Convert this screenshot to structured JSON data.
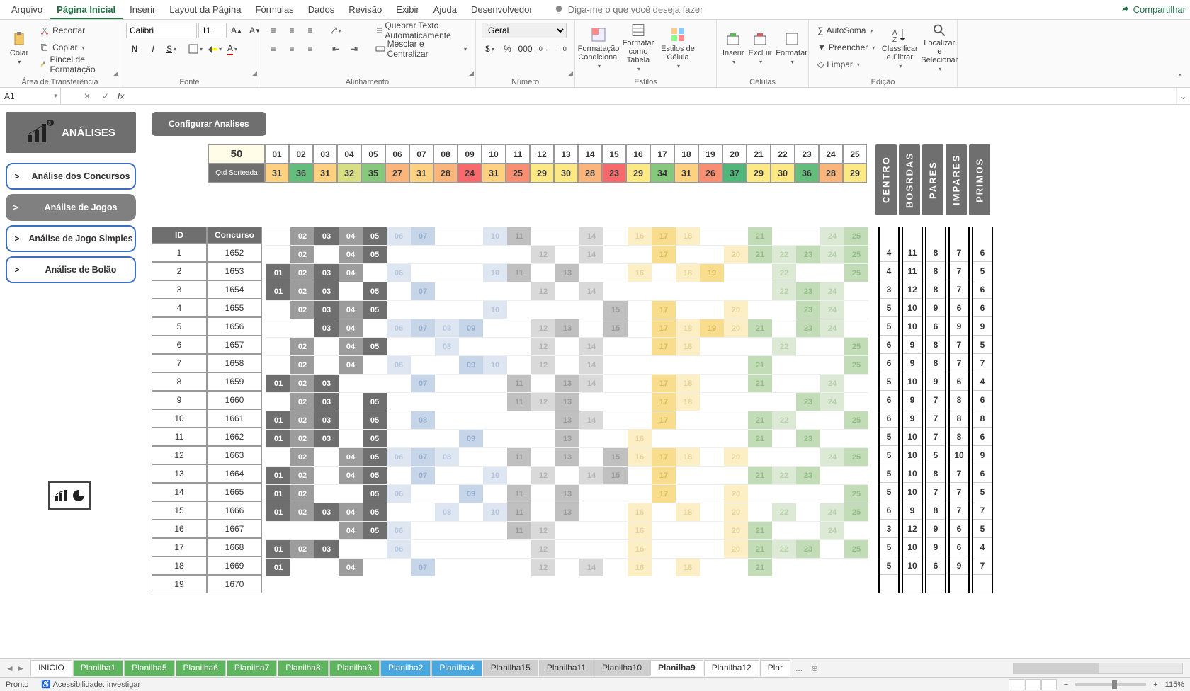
{
  "menu": {
    "items": [
      "Arquivo",
      "Página Inicial",
      "Inserir",
      "Layout da Página",
      "Fórmulas",
      "Dados",
      "Revisão",
      "Exibir",
      "Ajuda",
      "Desenvolvedor"
    ],
    "active": 1,
    "tellme": "Diga-me o que você deseja fazer",
    "share": "Compartilhar"
  },
  "ribbon": {
    "clipboard": {
      "paste": "Colar",
      "cut": "Recortar",
      "copy": "Copiar",
      "painter": "Pincel de Formatação",
      "label": "Área de Transferência"
    },
    "font": {
      "name": "Calibri",
      "size": "11",
      "label": "Fonte"
    },
    "alignment": {
      "wrap": "Quebrar Texto Automaticamente",
      "merge": "Mesclar e Centralizar",
      "label": "Alinhamento"
    },
    "number": {
      "format": "Geral",
      "label": "Número"
    },
    "styles": {
      "cond": "Formatação Condicional",
      "table": "Formatar como Tabela",
      "cell": "Estilos de Célula",
      "label": "Estilos"
    },
    "cells": {
      "insert": "Inserir",
      "delete": "Excluir",
      "format": "Formatar",
      "label": "Células"
    },
    "editing": {
      "sum": "AutoSoma",
      "fill": "Preencher",
      "clear": "Limpar",
      "sort": "Classificar e Filtrar",
      "find": "Localizar e Selecionar",
      "label": "Edição"
    }
  },
  "namebox": "A1",
  "panel": {
    "title": "ANÁLISES",
    "buttons": [
      "Análise dos Concursos",
      "Análise de Jogos",
      "Análise de Jogo Simples",
      "Análise de Bolão"
    ],
    "active": 1,
    "config": "Configurar Analises"
  },
  "vert_labels": [
    "CENTRO",
    "BOSRDAS",
    "PARES",
    "IMPARES",
    "PRIMOS"
  ],
  "header": {
    "total": "50",
    "qtd_label": "Qtd Sorteada",
    "cols": [
      "01",
      "02",
      "03",
      "04",
      "05",
      "06",
      "07",
      "08",
      "09",
      "10",
      "11",
      "12",
      "13",
      "14",
      "15",
      "16",
      "17",
      "18",
      "19",
      "20",
      "21",
      "22",
      "23",
      "24",
      "25"
    ],
    "vals": [
      "31",
      "36",
      "31",
      "32",
      "35",
      "27",
      "31",
      "28",
      "24",
      "31",
      "25",
      "29",
      "30",
      "28",
      "23",
      "29",
      "34",
      "31",
      "26",
      "37",
      "29",
      "30",
      "36",
      "28",
      "29"
    ],
    "heat": [
      "h-y3",
      "h-g1",
      "h-y3",
      "h-y1",
      "h-g2",
      "h-o1",
      "h-y3",
      "h-o1",
      "h-r1",
      "h-y3",
      "h-o2",
      "h-y2",
      "h-y2",
      "h-o1",
      "h-r1",
      "h-y2",
      "h-g2",
      "h-y3",
      "h-o2",
      "h-g0",
      "h-y2",
      "h-y2",
      "h-g1",
      "h-o1",
      "h-y2"
    ]
  },
  "table": {
    "id_hdr": "ID",
    "con_hdr": "Concurso",
    "rows": [
      {
        "id": "1",
        "con": "1652",
        "cells": [
          "",
          "02",
          "03",
          "04",
          "05",
          "06",
          "07",
          "",
          "",
          "10",
          "11",
          "",
          "",
          "14",
          "",
          "16",
          "17",
          "18",
          "",
          "",
          "21",
          "",
          "",
          "24",
          "25"
        ],
        "stats": [
          "4",
          "11",
          "8",
          "7",
          "6"
        ]
      },
      {
        "id": "2",
        "con": "1653",
        "cells": [
          "",
          "02",
          "",
          "04",
          "05",
          "",
          "",
          "",
          "",
          "",
          "",
          "12",
          "",
          "14",
          "",
          "",
          "17",
          "",
          "",
          "20",
          "21",
          "22",
          "23",
          "24",
          "25"
        ],
        "stats": [
          "4",
          "11",
          "8",
          "7",
          "5"
        ]
      },
      {
        "id": "3",
        "con": "1654",
        "cells": [
          "01",
          "02",
          "03",
          "04",
          "",
          "06",
          "",
          "",
          "",
          "10",
          "11",
          "",
          "13",
          "",
          "",
          "16",
          "",
          "18",
          "19",
          "",
          "",
          "22",
          "",
          "",
          "25"
        ],
        "stats": [
          "3",
          "12",
          "8",
          "7",
          "6"
        ]
      },
      {
        "id": "4",
        "con": "1655",
        "cells": [
          "01",
          "02",
          "03",
          "",
          "05",
          "",
          "07",
          "",
          "",
          "",
          "",
          "12",
          "",
          "14",
          "",
          "",
          "",
          "",
          "",
          "",
          "",
          "22",
          "23",
          "24",
          ""
        ],
        "stats": [
          "5",
          "10",
          "9",
          "6",
          "6"
        ]
      },
      {
        "id": "5",
        "con": "1656",
        "cells": [
          "",
          "02",
          "03",
          "04",
          "05",
          "",
          "",
          "",
          "",
          "10",
          "",
          "",
          "",
          "",
          "15",
          "",
          "17",
          "",
          "",
          "20",
          "",
          "",
          "23",
          "24",
          ""
        ],
        "stats": [
          "5",
          "10",
          "6",
          "9",
          "9"
        ]
      },
      {
        "id": "6",
        "con": "1657",
        "cells": [
          "",
          "",
          "03",
          "04",
          "",
          "06",
          "07",
          "08",
          "09",
          "",
          "",
          "12",
          "13",
          "",
          "15",
          "",
          "17",
          "18",
          "19",
          "20",
          "21",
          "",
          "23",
          "24",
          ""
        ],
        "stats": [
          "6",
          "9",
          "8",
          "7",
          "5"
        ]
      },
      {
        "id": "7",
        "con": "1658",
        "cells": [
          "",
          "02",
          "",
          "04",
          "05",
          "",
          "",
          "08",
          "",
          "",
          "",
          "12",
          "",
          "14",
          "",
          "",
          "17",
          "18",
          "",
          "",
          "",
          "22",
          "",
          "",
          "25"
        ],
        "stats": [
          "6",
          "9",
          "8",
          "7",
          "7"
        ]
      },
      {
        "id": "8",
        "con": "1659",
        "cells": [
          "",
          "02",
          "",
          "04",
          "",
          "06",
          "",
          "",
          "09",
          "10",
          "",
          "12",
          "",
          "14",
          "",
          "",
          "",
          "",
          "",
          "",
          "21",
          "",
          "",
          "",
          "25"
        ],
        "stats": [
          "5",
          "10",
          "9",
          "6",
          "4"
        ]
      },
      {
        "id": "9",
        "con": "1660",
        "cells": [
          "01",
          "02",
          "03",
          "",
          "",
          "",
          "07",
          "",
          "",
          "",
          "11",
          "",
          "13",
          "14",
          "",
          "",
          "17",
          "18",
          "",
          "",
          "21",
          "",
          "",
          "24",
          ""
        ],
        "stats": [
          "6",
          "9",
          "7",
          "8",
          "6"
        ]
      },
      {
        "id": "10",
        "con": "1661",
        "cells": [
          "",
          "02",
          "03",
          "",
          "05",
          "",
          "",
          "",
          "",
          "",
          "11",
          "12",
          "13",
          "",
          "",
          "",
          "17",
          "18",
          "",
          "",
          "",
          "",
          "23",
          "24",
          ""
        ],
        "stats": [
          "6",
          "9",
          "7",
          "8",
          "8"
        ]
      },
      {
        "id": "11",
        "con": "1662",
        "cells": [
          "01",
          "02",
          "03",
          "",
          "05",
          "",
          "08",
          "",
          "",
          "",
          "",
          "",
          "13",
          "14",
          "",
          "",
          "17",
          "",
          "",
          "",
          "21",
          "22",
          "",
          "",
          "25"
        ],
        "stats": [
          "5",
          "10",
          "7",
          "8",
          "6"
        ]
      },
      {
        "id": "12",
        "con": "1663",
        "cells": [
          "01",
          "02",
          "03",
          "",
          "05",
          "",
          "",
          "",
          "09",
          "",
          "",
          "",
          "13",
          "",
          "",
          "16",
          "",
          "",
          "",
          "",
          "21",
          "",
          "23",
          "",
          ""
        ],
        "stats": [
          "5",
          "10",
          "5",
          "10",
          "9"
        ]
      },
      {
        "id": "13",
        "con": "1664",
        "cells": [
          "",
          "02",
          "",
          "04",
          "05",
          "06",
          "07",
          "08",
          "",
          "",
          "11",
          "",
          "13",
          "",
          "15",
          "16",
          "17",
          "18",
          "",
          "20",
          "",
          "",
          "",
          "24",
          "25"
        ],
        "stats": [
          "5",
          "10",
          "8",
          "7",
          "6"
        ]
      },
      {
        "id": "14",
        "con": "1665",
        "cells": [
          "01",
          "02",
          "",
          "04",
          "05",
          "",
          "07",
          "",
          "",
          "10",
          "",
          "12",
          "",
          "14",
          "15",
          "",
          "17",
          "",
          "",
          "",
          "21",
          "22",
          "23",
          "",
          ""
        ],
        "stats": [
          "5",
          "10",
          "7",
          "7",
          "5"
        ]
      },
      {
        "id": "15",
        "con": "1666",
        "cells": [
          "01",
          "02",
          "",
          "",
          "05",
          "06",
          "",
          "",
          "09",
          "",
          "11",
          "",
          "13",
          "",
          "",
          "",
          "17",
          "",
          "",
          "20",
          "",
          "",
          "",
          "",
          "25"
        ],
        "stats": [
          "6",
          "9",
          "8",
          "7",
          "7"
        ]
      },
      {
        "id": "16",
        "con": "1667",
        "cells": [
          "01",
          "02",
          "03",
          "04",
          "05",
          "",
          "",
          "08",
          "",
          "10",
          "11",
          "",
          "13",
          "",
          "",
          "16",
          "",
          "18",
          "",
          "20",
          "",
          "22",
          "",
          "24",
          "25"
        ],
        "stats": [
          "3",
          "12",
          "9",
          "6",
          "5"
        ]
      },
      {
        "id": "17",
        "con": "1668",
        "cells": [
          "",
          "",
          "",
          "04",
          "05",
          "06",
          "",
          "",
          "",
          "",
          "11",
          "12",
          "",
          "",
          "",
          "16",
          "",
          "",
          "",
          "20",
          "21",
          "",
          "",
          "24",
          ""
        ],
        "stats": [
          "5",
          "10",
          "9",
          "6",
          "4"
        ]
      },
      {
        "id": "18",
        "con": "1669",
        "cells": [
          "01",
          "02",
          "03",
          "",
          "",
          "06",
          "",
          "",
          "",
          "",
          "",
          "12",
          "",
          "",
          "",
          "16",
          "",
          "",
          "",
          "20",
          "21",
          "22",
          "23",
          "",
          "25"
        ],
        "stats": [
          "5",
          "10",
          "6",
          "9",
          "7"
        ]
      },
      {
        "id": "19",
        "con": "1670",
        "cells": [
          "01",
          "",
          "",
          "04",
          "",
          "",
          "07",
          "",
          "",
          "",
          "",
          "12",
          "",
          "14",
          "",
          "16",
          "",
          "18",
          "",
          "",
          "21",
          "",
          "",
          "",
          ""
        ],
        "stats": [
          "",
          "",
          "",
          "",
          ""
        ]
      }
    ]
  },
  "tabs": {
    "items": [
      {
        "name": "INICIO",
        "cls": ""
      },
      {
        "name": "Planilha1",
        "cls": "green"
      },
      {
        "name": "Planilha5",
        "cls": "green"
      },
      {
        "name": "Planilha6",
        "cls": "green"
      },
      {
        "name": "Planilha7",
        "cls": "green"
      },
      {
        "name": "Planilha8",
        "cls": "green"
      },
      {
        "name": "Planilha3",
        "cls": "green"
      },
      {
        "name": "Planilha2",
        "cls": "blue"
      },
      {
        "name": "Planilha4",
        "cls": "blue"
      },
      {
        "name": "Planilha15",
        "cls": "gray"
      },
      {
        "name": "Planilha11",
        "cls": "gray"
      },
      {
        "name": "Planilha10",
        "cls": "gray"
      },
      {
        "name": "Planilha9",
        "cls": "active"
      },
      {
        "name": "Planilha12",
        "cls": ""
      },
      {
        "name": "Plar",
        "cls": ""
      }
    ]
  },
  "status": {
    "ready": "Pronto",
    "access": "Acessibilidade: investigar",
    "zoom": "115%"
  }
}
